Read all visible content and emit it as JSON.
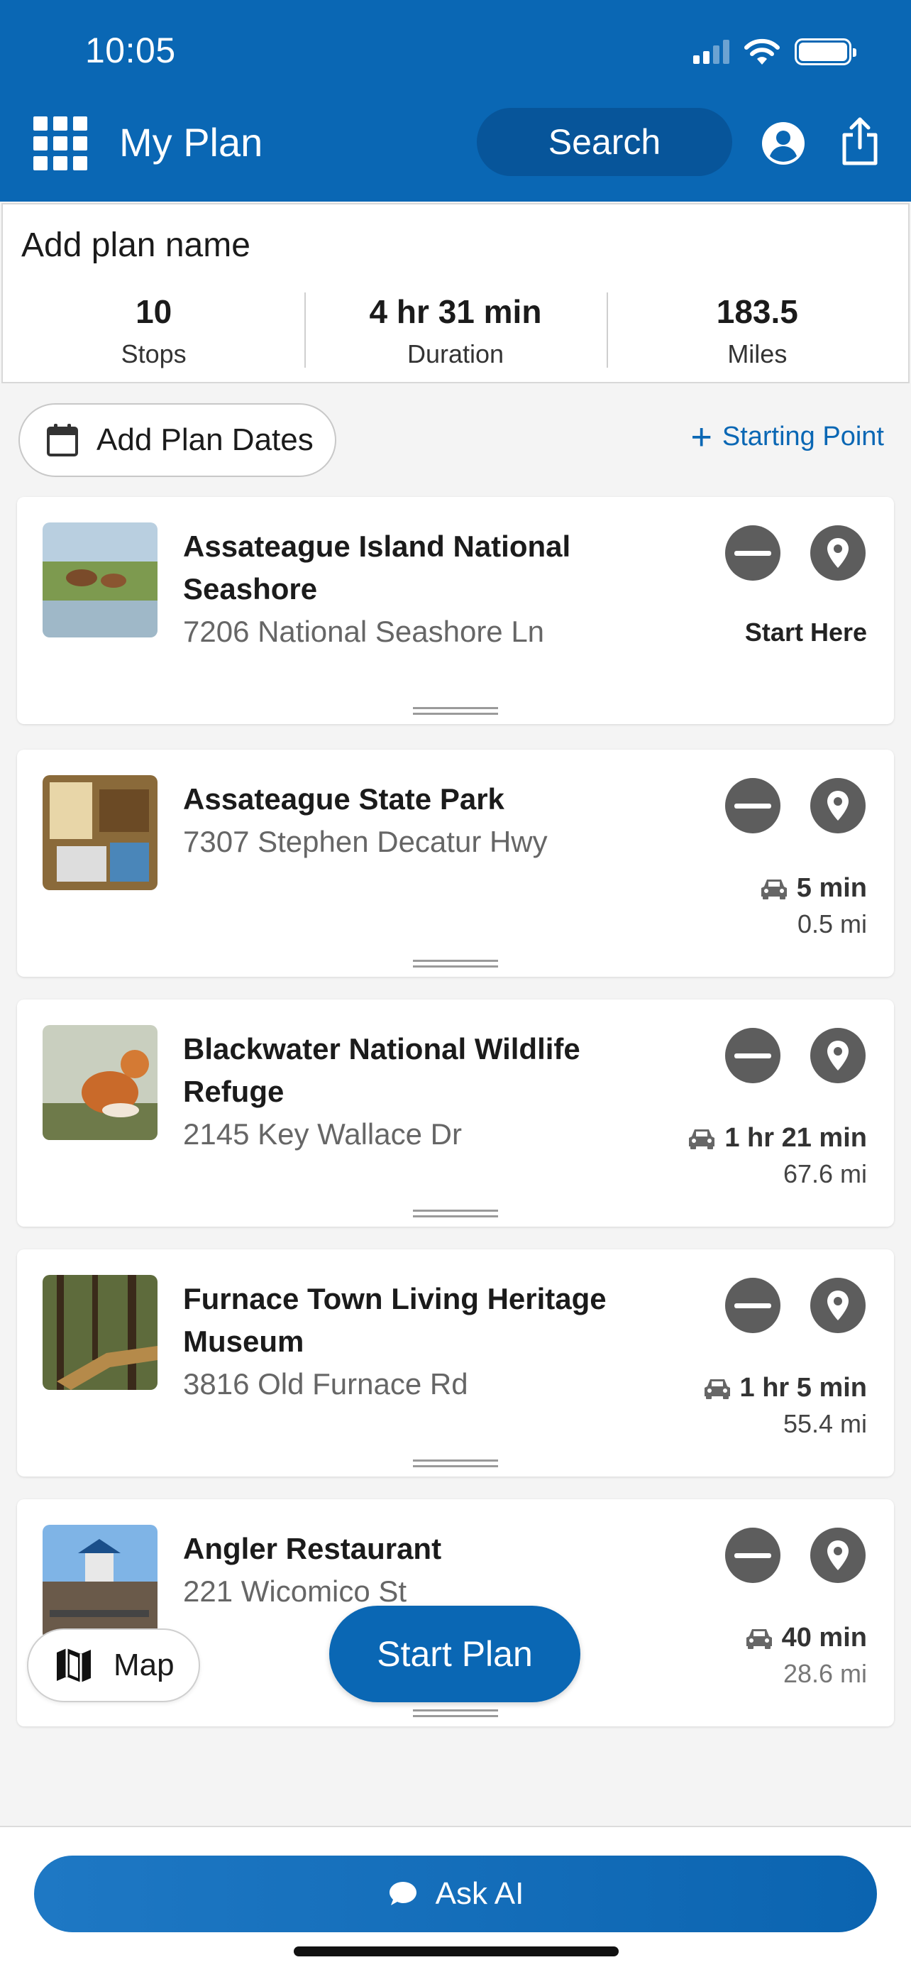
{
  "status_bar": {
    "time": "10:05"
  },
  "header": {
    "title": "My Plan",
    "search_label": "Search"
  },
  "plan": {
    "name_placeholder": "Add plan name",
    "stats": [
      {
        "value": "10",
        "label": "Stops"
      },
      {
        "value": "4 hr 31 min",
        "label": "Duration"
      },
      {
        "value": "183.5",
        "label": "Miles"
      }
    ]
  },
  "actions": {
    "add_dates_label": "Add Plan Dates",
    "starting_point_label": "Starting Point"
  },
  "stops": [
    {
      "name": "Assateague Island National Seashore",
      "address": "7206 National Seashore Ln",
      "badge": "Start Here"
    },
    {
      "name": "Assateague State Park",
      "address": "7307 Stephen Decatur Hwy",
      "drive_time": "5 min",
      "drive_distance": "0.5 mi"
    },
    {
      "name": "Blackwater National Wildlife Refuge",
      "address": "2145 Key Wallace Dr",
      "drive_time": "1 hr 21 min",
      "drive_distance": "67.6 mi"
    },
    {
      "name": "Furnace Town Living Heritage Museum",
      "address": "3816 Old Furnace Rd",
      "drive_time": "1 hr 5 min",
      "drive_distance": "55.4 mi"
    },
    {
      "name": "Angler Restaurant",
      "address": "221 Wicomico St",
      "drive_time": "40 min",
      "drive_distance": "28.6 mi"
    }
  ],
  "floating": {
    "map_label": "Map",
    "start_plan_label": "Start Plan"
  },
  "bottom": {
    "ask_ai_label": "Ask AI"
  },
  "colors": {
    "brand_blue": "#0a67b4",
    "icon_gray": "#5d5d5d"
  }
}
